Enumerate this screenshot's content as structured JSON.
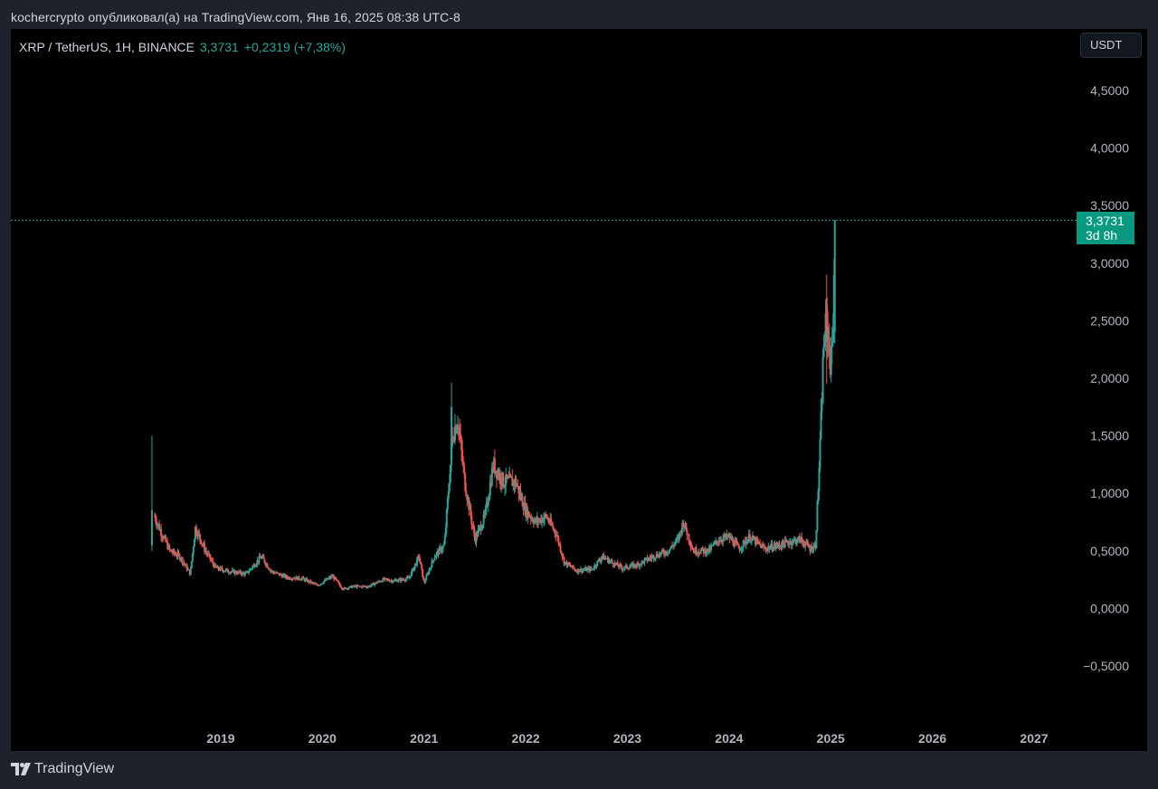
{
  "header": {
    "caption": "kochercrypto опубликовал(а) на TradingView.com, Янв 16, 2025 08:38 UTC-8"
  },
  "legend": {
    "symbol": "XRP / TetherUS, 1H, BINANCE",
    "price": "3,3731",
    "change": "+0,2319 (+7,38%)"
  },
  "currency_button": "USDT",
  "price_tag": {
    "value": "3,3731",
    "countdown": "3d 8h"
  },
  "footer": {
    "brand": "TradingView"
  },
  "colors": {
    "background": "#1e222d",
    "plot": "#000000",
    "up": "#26a69a",
    "down": "#ef5350",
    "axis_text": "#b2b5be"
  },
  "chart_data": {
    "type": "candlestick",
    "symbol": "XRP / TetherUS",
    "interval": "1H",
    "exchange": "BINANCE",
    "last_price": 3.3731,
    "ylim": [
      -0.8,
      4.7
    ],
    "xlim": [
      2018.25,
      2027.5
    ],
    "y_ticks": [
      4.5,
      4.0,
      3.5,
      3.0,
      2.5,
      2.0,
      1.5,
      1.0,
      0.5,
      0.0,
      -0.5
    ],
    "y_tick_labels": [
      "4,5000",
      "4,0000",
      "3,5000",
      "3,0000",
      "2,5000",
      "2,0000",
      "1,5000",
      "1,0000",
      "0,5000",
      "0,0000",
      "−0,5000"
    ],
    "x_ticks": [
      2019,
      2020,
      2021,
      2022,
      2023,
      2024,
      2025,
      2026,
      2027
    ],
    "x_tick_labels": [
      "2019",
      "2020",
      "2021",
      "2022",
      "2023",
      "2024",
      "2025",
      "2026",
      "2027"
    ],
    "price_line": 3.3731,
    "grid": false,
    "approx_closes": [
      [
        2018.35,
        0.8
      ],
      [
        2018.42,
        0.65
      ],
      [
        2018.5,
        0.5
      ],
      [
        2018.6,
        0.45
      ],
      [
        2018.7,
        0.3
      ],
      [
        2018.75,
        0.7
      ],
      [
        2018.85,
        0.5
      ],
      [
        2018.95,
        0.35
      ],
      [
        2019.1,
        0.32
      ],
      [
        2019.25,
        0.3
      ],
      [
        2019.4,
        0.45
      ],
      [
        2019.5,
        0.32
      ],
      [
        2019.65,
        0.27
      ],
      [
        2019.8,
        0.26
      ],
      [
        2019.95,
        0.2
      ],
      [
        2020.1,
        0.28
      ],
      [
        2020.2,
        0.17
      ],
      [
        2020.3,
        0.19
      ],
      [
        2020.45,
        0.19
      ],
      [
        2020.6,
        0.25
      ],
      [
        2020.7,
        0.24
      ],
      [
        2020.85,
        0.26
      ],
      [
        2020.95,
        0.45
      ],
      [
        2021.0,
        0.22
      ],
      [
        2021.1,
        0.45
      ],
      [
        2021.2,
        0.55
      ],
      [
        2021.28,
        1.5
      ],
      [
        2021.33,
        1.65
      ],
      [
        2021.4,
        1.1
      ],
      [
        2021.5,
        0.6
      ],
      [
        2021.6,
        0.8
      ],
      [
        2021.68,
        1.25
      ],
      [
        2021.78,
        1.1
      ],
      [
        2021.9,
        1.1
      ],
      [
        2022.0,
        0.85
      ],
      [
        2022.1,
        0.75
      ],
      [
        2022.2,
        0.8
      ],
      [
        2022.3,
        0.65
      ],
      [
        2022.38,
        0.4
      ],
      [
        2022.5,
        0.33
      ],
      [
        2022.65,
        0.34
      ],
      [
        2022.75,
        0.45
      ],
      [
        2022.85,
        0.4
      ],
      [
        2022.95,
        0.35
      ],
      [
        2023.1,
        0.38
      ],
      [
        2023.25,
        0.45
      ],
      [
        2023.4,
        0.5
      ],
      [
        2023.5,
        0.6
      ],
      [
        2023.55,
        0.75
      ],
      [
        2023.65,
        0.5
      ],
      [
        2023.8,
        0.5
      ],
      [
        2023.9,
        0.6
      ],
      [
        2024.0,
        0.62
      ],
      [
        2024.1,
        0.52
      ],
      [
        2024.2,
        0.62
      ],
      [
        2024.35,
        0.52
      ],
      [
        2024.5,
        0.55
      ],
      [
        2024.6,
        0.58
      ],
      [
        2024.7,
        0.6
      ],
      [
        2024.8,
        0.52
      ],
      [
        2024.85,
        0.55
      ],
      [
        2024.88,
        1.1
      ],
      [
        2024.9,
        1.5
      ],
      [
        2024.93,
        2.3
      ],
      [
        2024.96,
        2.5
      ],
      [
        2025.0,
        2.1
      ],
      [
        2025.02,
        2.4
      ],
      [
        2025.04,
        3.3731
      ]
    ]
  }
}
